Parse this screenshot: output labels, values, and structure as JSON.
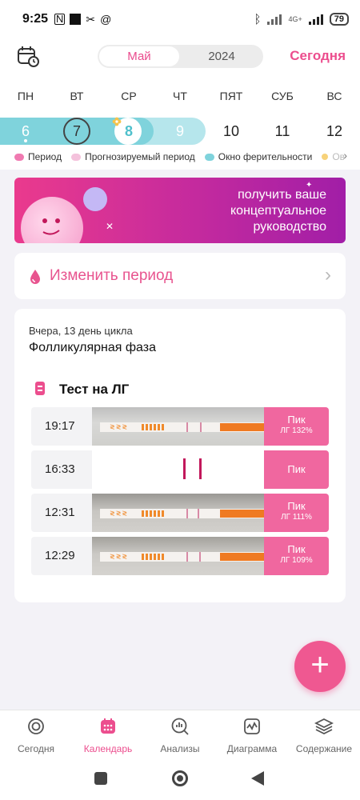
{
  "status_bar": {
    "time": "9:25",
    "battery": "79",
    "network": "4G+"
  },
  "header": {
    "month": "Май",
    "year": "2024",
    "today": "Сегодня"
  },
  "week": {
    "weekdays": [
      "ПН",
      "ВТ",
      "СР",
      "ЧТ",
      "ПЯТ",
      "СУБ",
      "ВС"
    ],
    "days": [
      "6",
      "7",
      "8",
      "9",
      "10",
      "11",
      "12"
    ],
    "selected_day": "8",
    "legend": [
      {
        "label": "Период",
        "color": "#f07ab1"
      },
      {
        "label": "Прогнозируемый период",
        "color": "#f4c2dc"
      },
      {
        "label": "Окно ферительности",
        "color": "#7fd3dc"
      },
      {
        "label": "Ов",
        "color": "#f7d27a"
      }
    ]
  },
  "banner": {
    "text": "получить ваше концептуальное руководство"
  },
  "edit_period": {
    "label": "Изменить период"
  },
  "cycle_info": {
    "day_line": "Вчера, 13 день цикла",
    "phase": "Фолликулярная фаза"
  },
  "lh_test": {
    "title": "Тест на ЛГ",
    "rows": [
      {
        "time": "19:17",
        "result": "Пик",
        "value": "ЛГ 132%",
        "photo": "strip"
      },
      {
        "time": "16:33",
        "result": "Пик",
        "value": "",
        "photo": "marks"
      },
      {
        "time": "12:31",
        "result": "Пик",
        "value": "ЛГ 111%",
        "photo": "strip"
      },
      {
        "time": "12:29",
        "result": "Пик",
        "value": "ЛГ 109%",
        "photo": "strip"
      }
    ]
  },
  "fab": {
    "label": "+"
  },
  "bottom_nav": [
    {
      "label": "Сегодня",
      "icon": "today-icon",
      "active": false
    },
    {
      "label": "Календарь",
      "icon": "calendar-icon",
      "active": true
    },
    {
      "label": "Анализы",
      "icon": "analysis-icon",
      "active": false
    },
    {
      "label": "Диаграмма",
      "icon": "chart-icon",
      "active": false
    },
    {
      "label": "Содержание",
      "icon": "layers-icon",
      "active": false
    }
  ],
  "colors": {
    "accent": "#ec4e8e",
    "fertile": "#7fd3dc",
    "fertile_light": "#b6e6ec",
    "peak": "#f0679f"
  }
}
